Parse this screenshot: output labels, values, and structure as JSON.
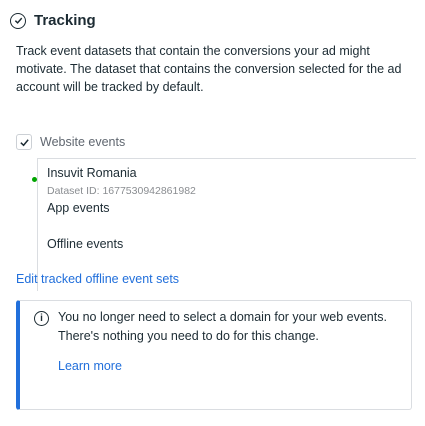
{
  "tracking": {
    "title": "Tracking",
    "description": "Track event datasets that contain the conversions your ad might motivate. The dataset that contains the conversion selected for the ad account will be tracked by default.",
    "website_events": {
      "label": "Website events",
      "checked": true
    },
    "dataset": {
      "name": "Insuvit Romania",
      "id_text": "Dataset ID: 1677530942861982",
      "status_color": "#00a400"
    },
    "app_events": {
      "label": "App events",
      "checked": false
    },
    "offline_events": {
      "label": "Offline events",
      "checked": false
    },
    "edit_link": "Edit tracked offline event sets"
  },
  "notice": {
    "icon": "info-icon",
    "text": "You no longer need to select a domain for your web events. There's nothing you need to do for this change.",
    "learn_more": "Learn more",
    "accent_color": "#216fdb"
  }
}
